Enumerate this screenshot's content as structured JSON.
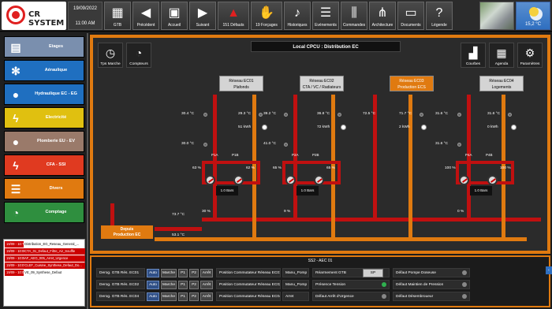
{
  "app": {
    "name": "CR SYSTEM",
    "date": "19/09/2022",
    "time": "11:00 AM"
  },
  "toolbar": [
    {
      "label": "GTB",
      "icon": "building-icon"
    },
    {
      "label": "Précédent",
      "icon": "arrow-left-icon"
    },
    {
      "label": "Accueil",
      "icon": "home-icon"
    },
    {
      "label": "Suivant",
      "icon": "arrow-right-icon"
    },
    {
      "label": "151 Défauts",
      "icon": "alarm-bell-icon"
    },
    {
      "label": "19 Forçages",
      "icon": "hand-icon"
    },
    {
      "label": "Historiques",
      "icon": "bell-icon"
    },
    {
      "label": "Evénements",
      "icon": "list-icon"
    },
    {
      "label": "Commandes",
      "icon": "sliders-icon"
    },
    {
      "label": "Architecture",
      "icon": "network-icon"
    },
    {
      "label": "Documents",
      "icon": "folder-icon"
    },
    {
      "label": "Légende",
      "icon": "question-icon"
    }
  ],
  "weather": {
    "temp": "15,2 °C"
  },
  "nav": [
    {
      "label": "Etages",
      "color": "#7a8fae"
    },
    {
      "label": "Aéraulique",
      "color": "#1f6fc0"
    },
    {
      "label": "Hydraulique EC - EG",
      "color": "#1f6fc0"
    },
    {
      "label": "Electricité",
      "color": "#e0c010"
    },
    {
      "label": "Plomberie EU - EV",
      "color": "#9a7a6a"
    },
    {
      "label": "CFA - SSI",
      "color": "#e03a20"
    },
    {
      "label": "Divers",
      "color": "#e07a10"
    },
    {
      "label": "Comptage",
      "color": "#2f8f3f"
    }
  ],
  "alarms": [
    {
      "date": "19/09 - 10:??",
      "text": "Distribution_EG_Reseau_General_...",
      "red": false
    },
    {
      "date": "19/09 - 10:00",
      "text": "CTA_01_Defaut_Filtre_Air_Souffle",
      "red": true
    },
    {
      "date": "19/09 - 10:00",
      "text": "AF_AEO_005_Arret_Urgence",
      "red": true
    },
    {
      "date": "19/09 - 10:07",
      "text": "CLEF_Cuisine_Synthese_Defaut_Do...",
      "red": true
    },
    {
      "date": "19/09 - 10:07",
      "text": "VE_09_Synthese_Defaut",
      "red": false
    }
  ],
  "main": {
    "title": "Local CPCU : Distribution EC",
    "left_buttons": [
      {
        "label": "Tps Marche",
        "icon": "clock-icon"
      },
      {
        "label": "Compteurs",
        "icon": "gauge-icon"
      }
    ],
    "right_buttons": [
      {
        "label": "Courbes",
        "icon": "chart-icon"
      },
      {
        "label": "Agenda",
        "icon": "calendar-icon"
      },
      {
        "label": "Paramètres",
        "icon": "settings-icon"
      }
    ],
    "networks": [
      {
        "name": "Réseau EC01",
        "sub": "Plafonds",
        "orange": false
      },
      {
        "name": "Réseau EC02",
        "sub": "CTA / VC / Radiateurs",
        "orange": false
      },
      {
        "name": "Réseau EC03",
        "sub": "Production ECS",
        "orange": true
      },
      {
        "name": "Réseau EC04",
        "sub": "Logements",
        "orange": false
      }
    ],
    "ec01": {
      "t1": "30.4 °C",
      "t2": "29.3 °C",
      "power": "51 kWh",
      "t3": "30.0 °C",
      "pa": "P1A",
      "pb": "P1B",
      "pct_a": "63 %",
      "pct_b": "62 %",
      "pressure": "1.0 Bars",
      "valve": "30 %"
    },
    "ec02": {
      "t1": "39.2 °C",
      "t2": "36.8 °C",
      "power": "72 kWh",
      "t3": "41.0 °C",
      "pa": "P2A",
      "pb": "P2B",
      "pct_a": "65 %",
      "pct_b": "65 %",
      "pressure": "1.0 Bars",
      "valve": "9 %"
    },
    "ec03": {
      "t1": "72.5 °C",
      "t2": "71.7 °C",
      "power": "2 kWh"
    },
    "ec04": {
      "t1": "31.6 °C",
      "t2": "31.6 °C",
      "power": "0 kWh",
      "t3": "31.6 °C",
      "pa": "P4A",
      "pb": "P4B",
      "pct_a": "100 %",
      "pct_b": "100 %",
      "pressure": "1.0 Bars",
      "valve": "0 %"
    },
    "supply_temp": "73.7 °C",
    "return_temp": "53.1 °C",
    "production": {
      "line1": "Depuis",
      "line2": "Production EC"
    }
  },
  "bottom": {
    "header": "SS2 - AEC 01",
    "derog_rows": [
      {
        "label": "Derog. GTB Rés. EC01"
      },
      {
        "label": "Derog. GTB Rés. EC02"
      },
      {
        "label": "Derog. GTB Rés. EC04"
      }
    ],
    "modes": [
      "Auto",
      "Marche",
      "P1",
      "P2",
      "Arrêt"
    ],
    "comm_rows": [
      {
        "label": "Position Commutateur Réseau EC01",
        "value": "Manu_Pomp"
      },
      {
        "label": "Position Commutateur Réseau EC02",
        "value": "Manu_Pomp"
      },
      {
        "label": "Position Commutateur Réseau EC04",
        "value": "Arret"
      }
    ],
    "status_rows": [
      {
        "label": "Réarmement GTB",
        "button": "SP"
      },
      {
        "label": "Présence Tension",
        "color": "#2fb04f"
      },
      {
        "label": "Défaut Arrêt d'Urgence",
        "color": "#888888"
      }
    ],
    "fault_rows": [
      {
        "label": "Défaut Pompe Doseuse"
      },
      {
        "label": "Défaut Maintien de Pression"
      },
      {
        "label": "Défaut Désembroueur"
      }
    ]
  }
}
